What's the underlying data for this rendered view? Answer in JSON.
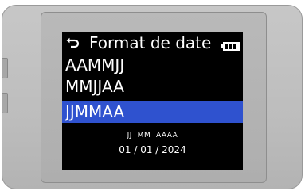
{
  "header": {
    "title": "Format de date",
    "back_icon": "back-arrow-icon",
    "battery_icon": "battery-full-icon"
  },
  "options": [
    {
      "label": "AAMMJJ",
      "selected": false
    },
    {
      "label": "MMJJAA",
      "selected": false
    },
    {
      "label": "JJMMAA",
      "selected": true
    }
  ],
  "preview": {
    "heading": "JJ  MM  AAAA",
    "date": "01 / 01 / 2024"
  },
  "colors": {
    "screen_bg": "#000000",
    "selection": "#2f52cf",
    "text": "#ffffff",
    "device_body": "#bdbdbd"
  }
}
